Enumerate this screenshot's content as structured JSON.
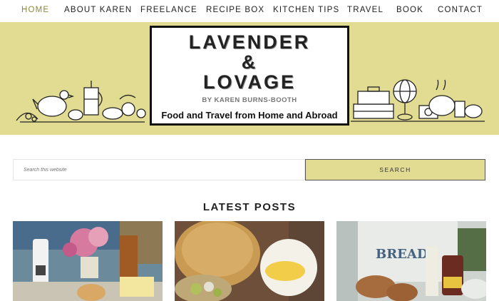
{
  "nav": {
    "items": [
      {
        "label": "HOME",
        "active": true
      },
      {
        "label": "ABOUT KAREN"
      },
      {
        "label": "FREELANCE"
      },
      {
        "label": "RECIPE BOX"
      },
      {
        "label": "KITCHEN TIPS"
      },
      {
        "label": "TRAVEL"
      },
      {
        "label": "BOOK"
      },
      {
        "label": "CONTACT"
      }
    ]
  },
  "logo": {
    "line1": "LAVENDER",
    "line2": "&",
    "line3": "LOVAGE",
    "byline": "BY KAREN BURNS-BOOTH",
    "tagline": "Food and Travel from Home and Abroad"
  },
  "search": {
    "placeholder": "Search this website",
    "button_label": "SEARCH"
  },
  "latest": {
    "heading": "LATEST POSTS",
    "posts": [
      {
        "image": "kefir-and-scones-photo"
      },
      {
        "image": "cornbread-and-custard-photo"
      },
      {
        "image": "bread-bin-and-pickle-photo"
      }
    ]
  },
  "colors": {
    "banner": "#e2dc93",
    "nav_active": "#8a8a3a"
  }
}
